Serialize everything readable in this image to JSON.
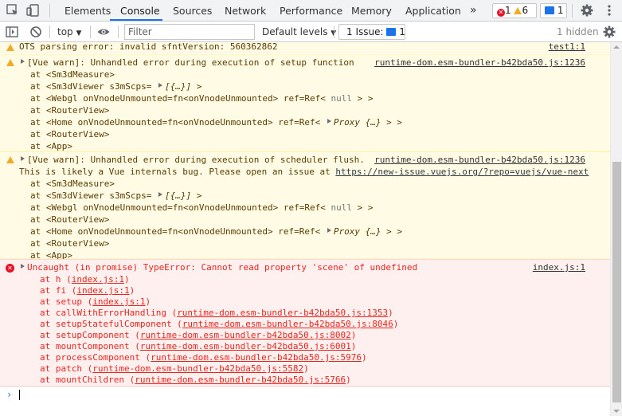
{
  "tabs": [
    "Elements",
    "Console",
    "Sources",
    "Network",
    "Performance",
    "Memory",
    "Application"
  ],
  "more_tabs": "»",
  "counts": {
    "errors": "1",
    "warnings": "6",
    "messages": "1"
  },
  "toolbar": {
    "context": "top",
    "filter_placeholder": "Filter",
    "levels": "Default levels",
    "issues_label": "1 Issue:",
    "issues_count": "1",
    "hidden": "1 hidden"
  },
  "console": {
    "top_line": {
      "text": "OTS parsing error: invalid sfntVersion: 560362862",
      "source": "test1:1"
    },
    "warn1": {
      "head": "[Vue warn]: Unhandled error during execution of setup function",
      "source": "runtime-dom.esm-bundler-b42bda50.js:1236",
      "l1": "at <Sm3dMeasure>",
      "l2a": "at <Sm3dViewer s3mScps=",
      "l2b": "[{…}]",
      "l2c": ">",
      "l3a": "at <Webgl onVnodeUnmounted=fn<onVnodeUnmounted> ref=Ref<",
      "l3b": "null",
      "l3c": "> >",
      "l4": "at <RouterView>",
      "l5a": "at <Home onVnodeUnmounted=fn<onVnodeUnmounted> ref=Ref<",
      "l5b": "Proxy {…}",
      "l5c": "> >",
      "l6": "at <RouterView>",
      "l7": "at <App>"
    },
    "warn2": {
      "head": "[Vue warn]: Unhandled error during execution of scheduler flush.",
      "source": "runtime-dom.esm-bundler-b42bda50.js:1236",
      "line2a": "This is likely a Vue internals bug. Please open an issue at ",
      "line2b": "https://new-issue.vuejs.org/?repo=vuejs/vue-next",
      "l1": "at <Sm3dMeasure>",
      "l2a": "at <Sm3dViewer s3mScps=",
      "l2b": "[{…}]",
      "l2c": ">",
      "l3a": "at <Webgl onVnodeUnmounted=fn<onVnodeUnmounted> ref=Ref<",
      "l3b": "null",
      "l3c": "> >",
      "l4": "at <RouterView>",
      "l5a": "at <Home onVnodeUnmounted=fn<onVnodeUnmounted> ref=Ref<",
      "l5b": "Proxy {…}",
      "l5c": "> >",
      "l6": "at <RouterView>",
      "l7": "at <App>"
    },
    "error": {
      "head": "Uncaught (in promise) TypeError: Cannot read property 'scene' of undefined",
      "source": "index.js:1",
      "stack": [
        {
          "fn": "at h (",
          "link": "index.js:1",
          "end": ")"
        },
        {
          "fn": "at fi (",
          "link": "index.js:1",
          "end": ")"
        },
        {
          "fn": "at setup (",
          "link": "index.js:1",
          "end": ")"
        },
        {
          "fn": "at callWithErrorHandling (",
          "link": "runtime-dom.esm-bundler-b42bda50.js:1353",
          "end": ")"
        },
        {
          "fn": "at setupStatefulComponent (",
          "link": "runtime-dom.esm-bundler-b42bda50.js:8046",
          "end": ")"
        },
        {
          "fn": "at setupComponent (",
          "link": "runtime-dom.esm-bundler-b42bda50.js:8002",
          "end": ")"
        },
        {
          "fn": "at mountComponent (",
          "link": "runtime-dom.esm-bundler-b42bda50.js:6001",
          "end": ")"
        },
        {
          "fn": "at processComponent (",
          "link": "runtime-dom.esm-bundler-b42bda50.js:5976",
          "end": ")"
        },
        {
          "fn": "at patch (",
          "link": "runtime-dom.esm-bundler-b42bda50.js:5582",
          "end": ")"
        },
        {
          "fn": "at mountChildren (",
          "link": "runtime-dom.esm-bundler-b42bda50.js:5766",
          "end": ")"
        }
      ]
    },
    "prompt": "›"
  },
  "colors": {
    "accent": "#1a73e8",
    "warning_bg": "#fffbe5",
    "error_bg": "#fff0f0",
    "error_text": "#e8251d"
  },
  "icons": [
    "inspect-element-icon",
    "device-toolbar-icon",
    "error-icon",
    "warning-icon",
    "message-icon",
    "settings-gear-icon",
    "more-vertical-icon",
    "sidebar-toggle-icon",
    "clear-console-icon",
    "eye-icon",
    "console-settings-icon"
  ]
}
